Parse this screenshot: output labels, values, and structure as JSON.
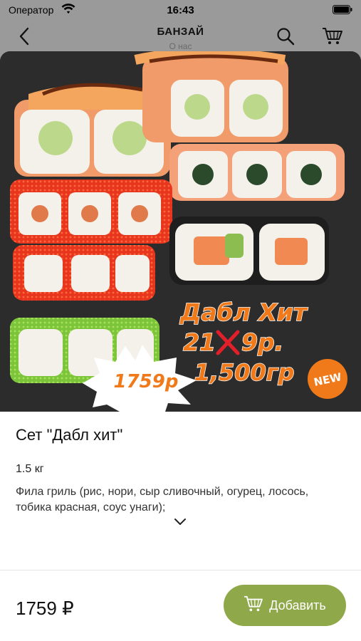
{
  "status_bar": {
    "carrier": "Оператор",
    "time": "16:43"
  },
  "nav": {
    "title": "БАНЗАЙ",
    "subtitle": "О нас"
  },
  "product": {
    "name": "Сет \"Дабл хит\"",
    "weight": "1.5 кг",
    "description": "Фила гриль (рис, нори, сыр сливочный, огурец, лосось, тобика красная, соус унаги);",
    "price": "1759 ₽",
    "add_button_label": "Добавить"
  },
  "promo_image": {
    "headline": "Дабл Хит",
    "old_price_left": "21",
    "old_price_right": "9р.",
    "weight": "1,500гр",
    "badge_price": "1759р",
    "new_badge": "NEW"
  },
  "colors": {
    "accent_green": "#8fa84a",
    "promo_orange": "#f07a1a",
    "hero_background": "#2c2c2c"
  },
  "icons": [
    "wifi-icon",
    "battery-icon",
    "back-arrow-icon",
    "search-icon",
    "cart-icon",
    "chevron-down-icon"
  ]
}
